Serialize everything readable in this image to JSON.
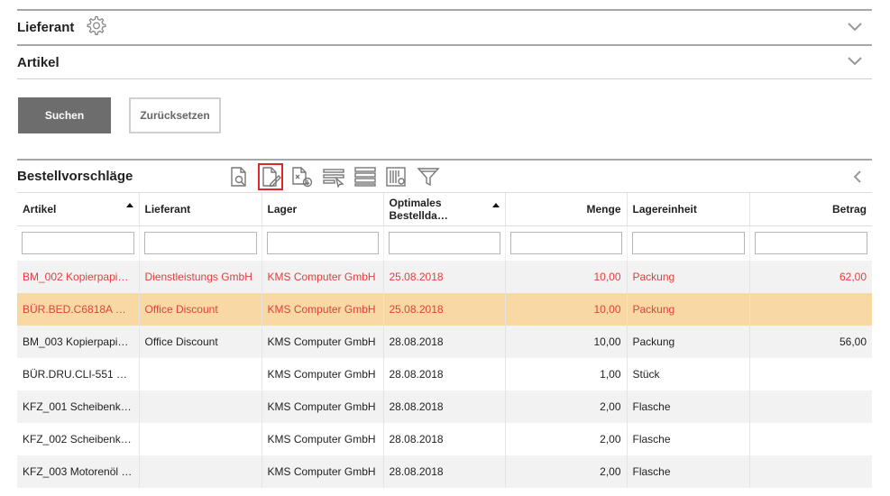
{
  "panels": [
    {
      "title": "Lieferant",
      "has_settings": true
    },
    {
      "title": "Artikel",
      "has_settings": false
    }
  ],
  "buttons": {
    "search": "Suchen",
    "reset": "Zurücksetzen"
  },
  "grid": {
    "title": "Bestellvorschläge",
    "toolbar_icons": [
      "document-search-icon",
      "document-edit-icon",
      "document-export-icon",
      "select-rows-icon",
      "list-rows-icon",
      "barcode-settings-icon",
      "filter-icon"
    ],
    "active_toolbar_icon": "document-edit-icon",
    "columns": [
      "Artikel",
      "Lieferant",
      "Lager",
      "Optimales Bestellda…",
      "Menge",
      "Lagereinheit",
      "Betrag"
    ],
    "sorted_columns": [
      "Artikel",
      "Optimales Bestellda…"
    ],
    "rows": [
      {
        "artikel": "BM_002 Kopierpapie…",
        "lieferant": "Dienstleistungs GmbH",
        "lager": "KMS Computer GmbH",
        "datum": "25.08.2018",
        "menge": "10,00",
        "einheit": "Packung",
        "betrag": "62,00",
        "status": "red"
      },
      {
        "artikel": "BÜR.BED.C6818A H…",
        "lieferant": "Office Discount",
        "lager": "KMS Computer GmbH",
        "datum": "25.08.2018",
        "menge": "10,00",
        "einheit": "Packung",
        "betrag": "",
        "status": "red-selected"
      },
      {
        "artikel": "BM_003 Kopierpapie…",
        "lieferant": "Office Discount",
        "lager": "KMS Computer GmbH",
        "datum": "28.08.2018",
        "menge": "10,00",
        "einheit": "Packung",
        "betrag": "56,00",
        "status": "normal"
      },
      {
        "artikel": "BÜR.DRU.CLI-551 B…",
        "lieferant": "",
        "lager": "KMS Computer GmbH",
        "datum": "28.08.2018",
        "menge": "1,00",
        "einheit": "Stück",
        "betrag": "",
        "status": "normal"
      },
      {
        "artikel": "KFZ_001 Scheibenkl…",
        "lieferant": "",
        "lager": "KMS Computer GmbH",
        "datum": "28.08.2018",
        "menge": "2,00",
        "einheit": "Flasche",
        "betrag": "",
        "status": "normal"
      },
      {
        "artikel": "KFZ_002 Scheibenkl…",
        "lieferant": "",
        "lager": "KMS Computer GmbH",
        "datum": "28.08.2018",
        "menge": "2,00",
        "einheit": "Flasche",
        "betrag": "",
        "status": "normal"
      },
      {
        "artikel": "KFZ_003 Motorenöl …",
        "lieferant": "",
        "lager": "KMS Computer GmbH",
        "datum": "28.08.2018",
        "menge": "2,00",
        "einheit": "Flasche",
        "betrag": "",
        "status": "normal"
      }
    ]
  },
  "colors": {
    "accent_red": "#e0403f",
    "selected_row": "#f8d9a3",
    "primary_button": "#6d6d6d"
  }
}
